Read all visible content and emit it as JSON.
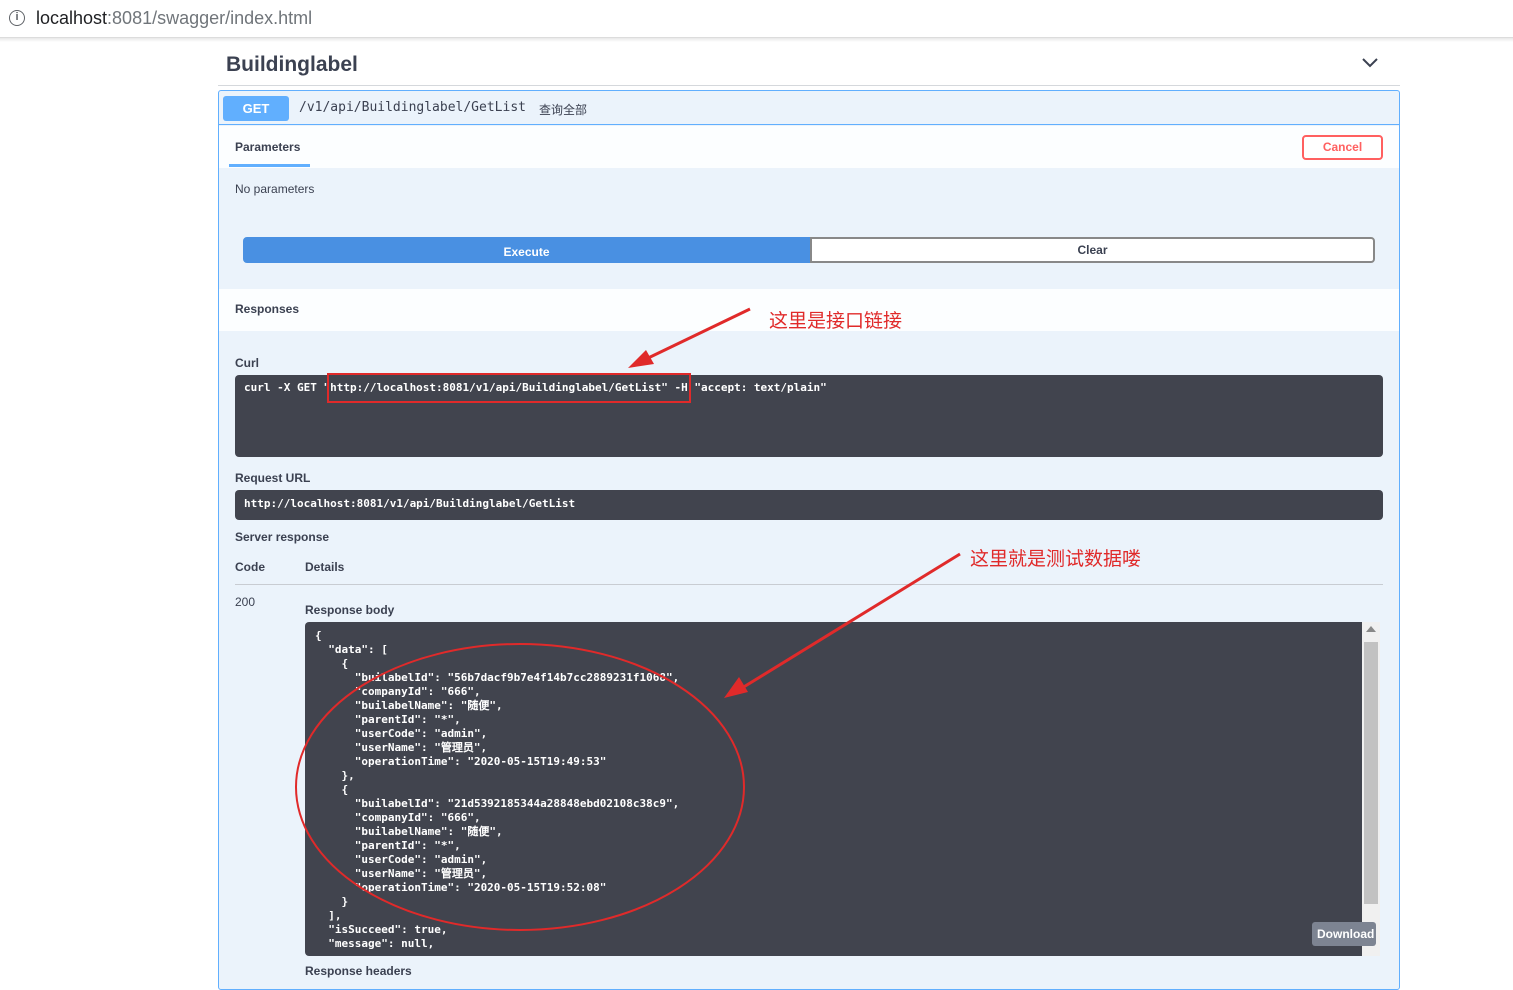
{
  "browser": {
    "url_host": "localhost",
    "url_path": ":8081/swagger/index.html"
  },
  "tag": {
    "title": "Buildinglabel"
  },
  "operation": {
    "method": "GET",
    "path": "/v1/api/Buildinglabel/GetList",
    "description": "查询全部",
    "parameters_tab": "Parameters",
    "cancel_label": "Cancel",
    "no_params_text": "No parameters",
    "execute_label": "Execute",
    "clear_label": "Clear"
  },
  "responses": {
    "title": "Responses",
    "curl_label": "Curl",
    "curl_command": "curl -X GET \"http://localhost:8081/v1/api/Buildinglabel/GetList\" -H \"accept: text/plain\"",
    "request_url_label": "Request URL",
    "request_url": "http://localhost:8081/v1/api/Buildinglabel/GetList",
    "server_response_label": "Server response",
    "code_header": "Code",
    "details_header": "Details",
    "code_value": "200",
    "response_body_label": "Response body",
    "response_body": "{\n  \"data\": [\n    {\n      \"builabelId\": \"56b7dacf9b7e4f14b7cc2889231f1068\",\n      \"companyId\": \"666\",\n      \"builabelName\": \"随便\",\n      \"parentId\": \"*\",\n      \"userCode\": \"admin\",\n      \"userName\": \"管理员\",\n      \"operationTime\": \"2020-05-15T19:49:53\"\n    },\n    {\n      \"builabelId\": \"21d5392185344a28848ebd02108c38c9\",\n      \"companyId\": \"666\",\n      \"builabelName\": \"随便\",\n      \"parentId\": \"*\",\n      \"userCode\": \"admin\",\n      \"userName\": \"管理员\",\n      \"operationTime\": \"2020-05-15T19:52:08\"\n    }\n  ],\n  \"isSucceed\": true,\n  \"message\": null,",
    "download_label": "Download",
    "response_headers_label": "Response headers"
  },
  "annotations": {
    "link_note": "这里是接口链接",
    "data_note": "这里就是测试数据喽",
    "color": "#e02a2a"
  },
  "colors": {
    "get_blue": "#61affe",
    "execute_blue": "#4990e2",
    "cancel_red": "#ff6060",
    "code_bg": "#41444e"
  }
}
